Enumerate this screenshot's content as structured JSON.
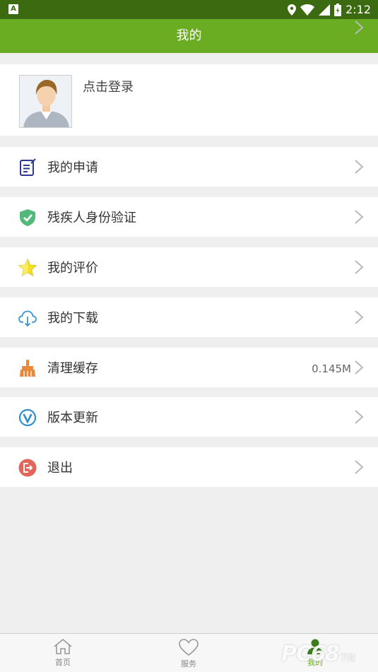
{
  "status_bar": {
    "sim_label": "A",
    "time": "2:12"
  },
  "header": {
    "title": "我的"
  },
  "profile": {
    "login_text": "点击登录"
  },
  "menu": [
    {
      "label": "我的申请",
      "icon": "application-icon"
    },
    {
      "label": "残疾人身份验证",
      "icon": "shield-check-icon"
    },
    {
      "label": "我的评价",
      "icon": "star-icon"
    },
    {
      "label": "我的下载",
      "icon": "cloud-download-icon"
    },
    {
      "label": "清理缓存",
      "icon": "broom-icon",
      "value": "0.145M"
    },
    {
      "label": "版本更新",
      "icon": "version-update-icon"
    },
    {
      "label": "退出",
      "icon": "logout-icon"
    }
  ],
  "tab_bar": {
    "tabs": [
      {
        "label": "首页",
        "icon": "home-icon"
      },
      {
        "label": "服务",
        "icon": "heart-icon"
      },
      {
        "label": "我的",
        "icon": "person-icon",
        "active": true
      }
    ]
  },
  "watermark": {
    "text": "PC",
    "text2": "6",
    "text3": "8",
    "text4": "下载"
  },
  "colors": {
    "accent": "#6aad23",
    "status_bar": "#3c6a11",
    "background": "#efefef"
  }
}
